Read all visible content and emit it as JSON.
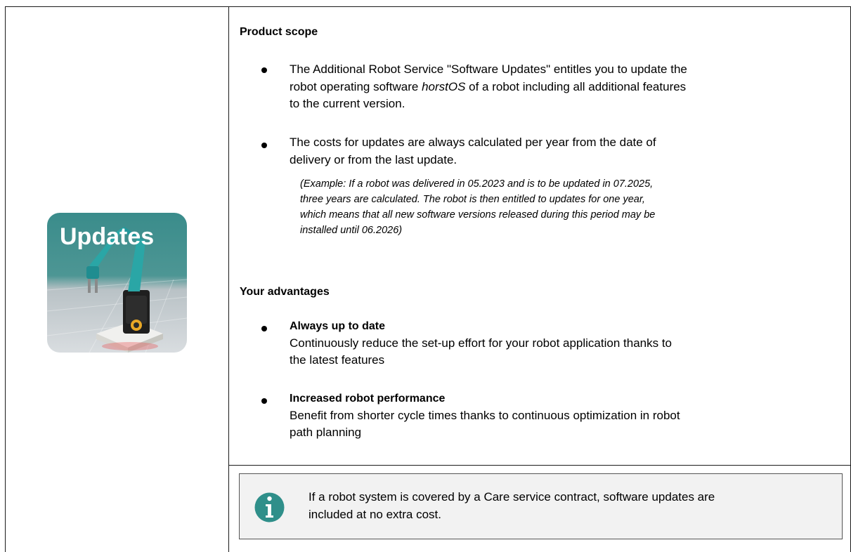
{
  "image": {
    "label": "Updates",
    "icon": "robot-arm-updates-image"
  },
  "product_scope": {
    "heading": "Product scope",
    "bullet1": {
      "line1": "The Additional Robot Service \"Software Updates\" entitles you to update the",
      "line2_prefix": "robot operating software ",
      "line2_italic": "horstOS",
      "line2_suffix": " of a robot including all additional features",
      "line3": "to the current version."
    },
    "bullet2": {
      "line1": "The costs for updates are always calculated per year from the date of",
      "line2": "delivery or from the last update."
    },
    "example": {
      "line1": "(Example: If a robot was delivered in 05.2023 and is to be updated in 07.2025,",
      "line2": "three years are calculated. The robot is then entitled to updates for one year,",
      "line3": "which means that all new software versions released during this period may be",
      "line4": "installed until 06.2026)"
    }
  },
  "advantages": {
    "heading": "Your advantages",
    "item1": {
      "title": "Always up to date",
      "line1": "Continuously reduce the set-up effort for your robot application thanks to",
      "line2": "the latest features"
    },
    "item2": {
      "title": "Increased robot performance",
      "line1": "Benefit from shorter cycle times thanks to continuous optimization in robot",
      "line2": "path planning"
    }
  },
  "info_box": {
    "icon": "info-icon",
    "line1": "If a robot system is covered by a Care service contract, software updates are",
    "line2": "included at no extra cost."
  },
  "colors": {
    "info_icon": "#2f8f8a",
    "image_teal": "#2e8f8f",
    "border": "#1a1a1a"
  }
}
